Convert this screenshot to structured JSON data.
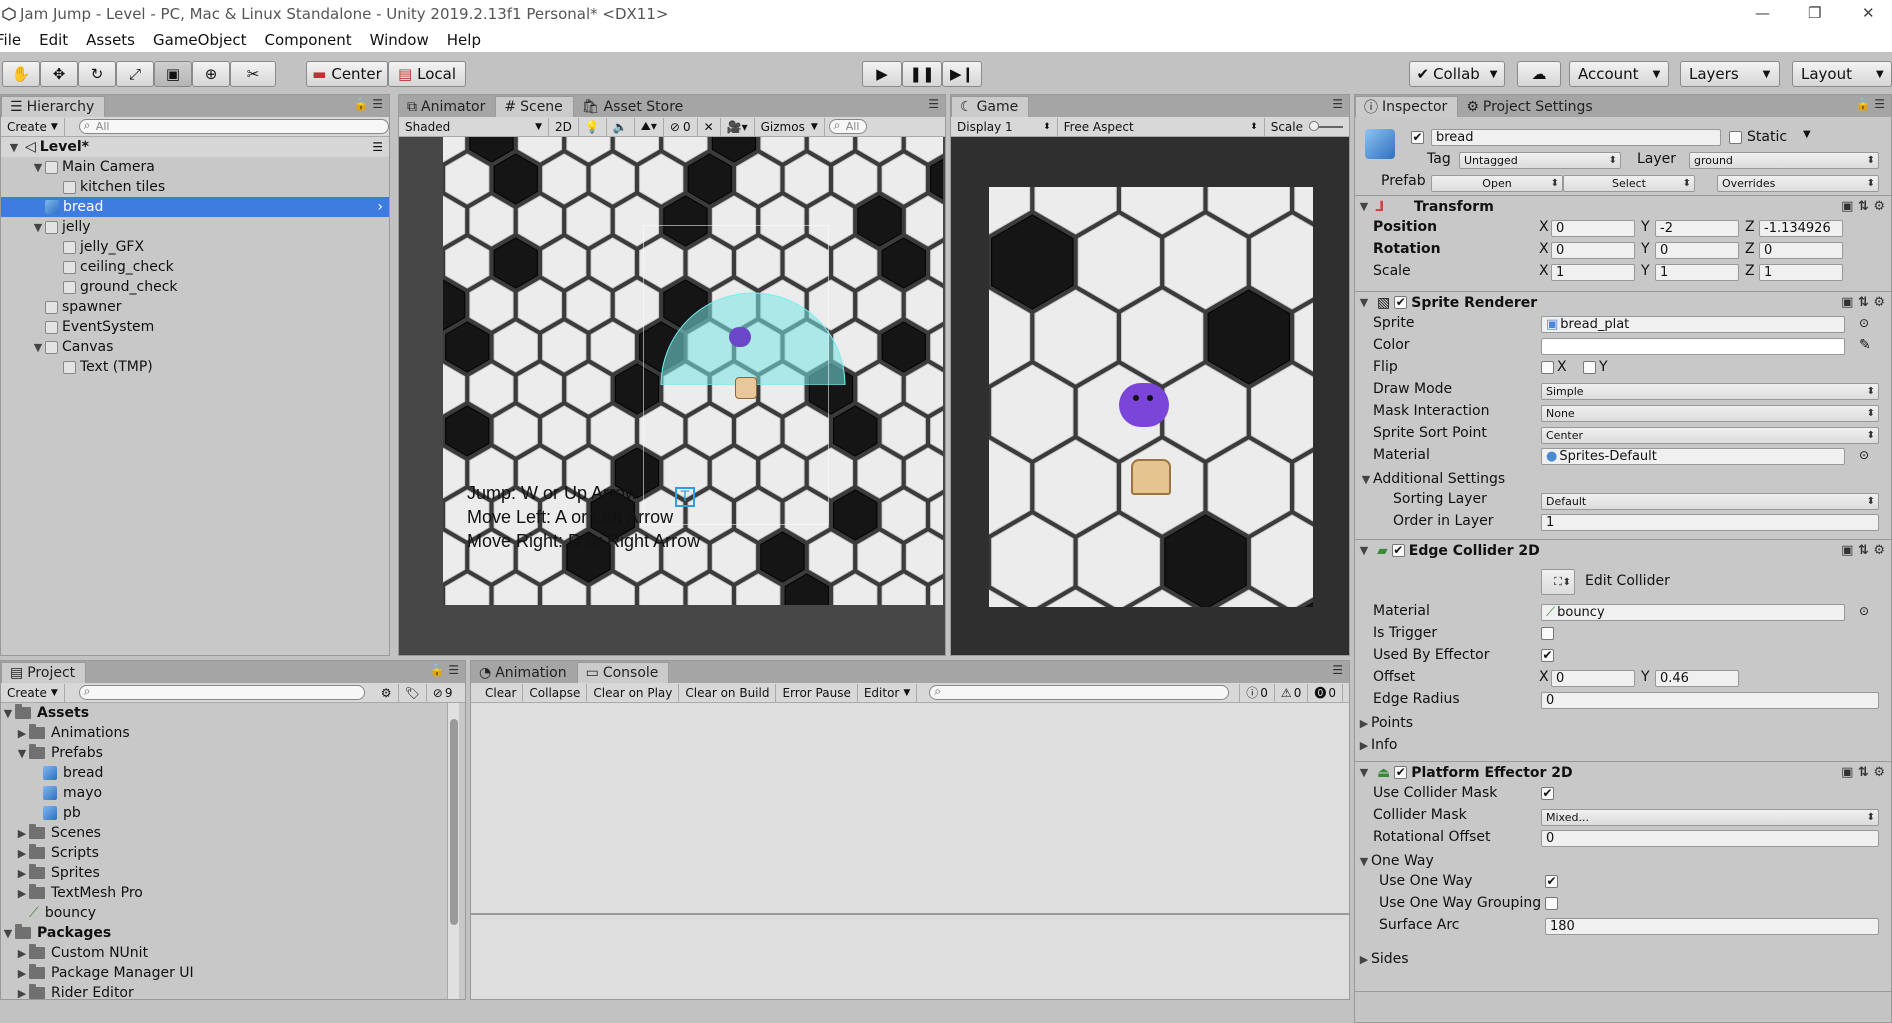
{
  "window": {
    "title": "Jam Jump - Level - PC, Mac & Linux Standalone - Unity 2019.2.13f1 Personal* <DX11>",
    "controls": [
      "—",
      "❐",
      "✕"
    ]
  },
  "menu": [
    "File",
    "Edit",
    "Assets",
    "GameObject",
    "Component",
    "Window",
    "Help"
  ],
  "toolbar": {
    "pivot": "Center",
    "space": "Local",
    "collab": "Collab",
    "account": "Account",
    "layers": "Layers",
    "layout": "Layout"
  },
  "hierarchy": {
    "tab": "Hierarchy",
    "create": "Create",
    "search_placeholder": "All",
    "scene": "Level*",
    "items": [
      {
        "label": "Main Camera",
        "depth": 1,
        "expanded": true
      },
      {
        "label": "kitchen tiles",
        "depth": 2
      },
      {
        "label": "bread",
        "depth": 1,
        "selected": true
      },
      {
        "label": "jelly",
        "depth": 1,
        "expanded": true
      },
      {
        "label": "jelly_GFX",
        "depth": 2
      },
      {
        "label": "ceiling_check",
        "depth": 2
      },
      {
        "label": "ground_check",
        "depth": 2
      },
      {
        "label": "spawner",
        "depth": 1
      },
      {
        "label": "EventSystem",
        "depth": 1
      },
      {
        "label": "Canvas",
        "depth": 1,
        "expanded": true
      },
      {
        "label": "Text (TMP)",
        "depth": 2
      }
    ]
  },
  "scene": {
    "tabs": [
      "Animator",
      "Scene",
      "Asset Store"
    ],
    "shading": "Shaded",
    "mode2d": "2D",
    "gizmo_count": "0",
    "gizmos": "Gizmos",
    "search_placeholder": "All",
    "ui_text": [
      "Jump: W or Up Arrow",
      "Move Left: A or Left Arrow",
      "Move Right: D or Right Arrow"
    ]
  },
  "game": {
    "tab": "Game",
    "display": "Display 1",
    "aspect": "Free Aspect",
    "scale": "Scale"
  },
  "project": {
    "tab": "Project",
    "create": "Create",
    "hidden_count": "9",
    "items": [
      {
        "label": "Assets",
        "depth": 0,
        "type": "folder",
        "bold": true,
        "expanded": true
      },
      {
        "label": "Animations",
        "depth": 1,
        "type": "folder"
      },
      {
        "label": "Prefabs",
        "depth": 1,
        "type": "folder",
        "expanded": true
      },
      {
        "label": "bread",
        "depth": 2,
        "type": "prefab"
      },
      {
        "label": "mayo",
        "depth": 2,
        "type": "prefab"
      },
      {
        "label": "pb",
        "depth": 2,
        "type": "prefab"
      },
      {
        "label": "Scenes",
        "depth": 1,
        "type": "folder"
      },
      {
        "label": "Scripts",
        "depth": 1,
        "type": "folder"
      },
      {
        "label": "Sprites",
        "depth": 1,
        "type": "folder"
      },
      {
        "label": "TextMesh Pro",
        "depth": 1,
        "type": "folder"
      },
      {
        "label": "bouncy",
        "depth": 1,
        "type": "material"
      },
      {
        "label": "Packages",
        "depth": 0,
        "type": "folder",
        "bold": true,
        "expanded": true
      },
      {
        "label": "Custom NUnit",
        "depth": 1,
        "type": "folder"
      },
      {
        "label": "Package Manager UI",
        "depth": 1,
        "type": "folder"
      },
      {
        "label": "Rider Editor",
        "depth": 1,
        "type": "folder"
      }
    ]
  },
  "console": {
    "tabs": [
      "Animation",
      "Console"
    ],
    "buttons": [
      "Clear",
      "Collapse",
      "Clear on Play",
      "Clear on Build",
      "Error Pause",
      "Editor"
    ],
    "counts": [
      "0",
      "0",
      "0"
    ]
  },
  "inspector": {
    "tabs": [
      "Inspector",
      "Project Settings"
    ],
    "name": "bread",
    "static_label": "Static",
    "tag_label": "Tag",
    "tag": "Untagged",
    "layer_label": "Layer",
    "layer": "ground",
    "prefab_label": "Prefab",
    "prefab_open": "Open",
    "prefab_select": "Select",
    "prefab_overrides": "Overrides",
    "transform": {
      "title": "Transform",
      "position_label": "Position",
      "pos_x": "0",
      "pos_y": "-2",
      "pos_z": "-1.134926",
      "rotation_label": "Rotation",
      "rot_x": "0",
      "rot_y": "0",
      "rot_z": "0",
      "scale_label": "Scale",
      "scl_x": "1",
      "scl_y": "1",
      "scl_z": "1"
    },
    "sprite_renderer": {
      "title": "Sprite Renderer",
      "sprite_label": "Sprite",
      "sprite": "bread_plat",
      "color_label": "Color",
      "flip_label": "Flip",
      "flip_x": "X",
      "flip_y": "Y",
      "draw_mode_label": "Draw Mode",
      "draw_mode": "Simple",
      "mask_label": "Mask Interaction",
      "mask": "None",
      "sort_point_label": "Sprite Sort Point",
      "sort_point": "Center",
      "material_label": "Material",
      "material": "Sprites-Default",
      "additional": "Additional Settings",
      "sorting_layer_label": "Sorting Layer",
      "sorting_layer": "Default",
      "order_label": "Order in Layer",
      "order": "1"
    },
    "edge_collider": {
      "title": "Edge Collider 2D",
      "edit_collider": "Edit Collider",
      "material_label": "Material",
      "material": "bouncy",
      "is_trigger_label": "Is Trigger",
      "used_by_effector_label": "Used By Effector",
      "offset_label": "Offset",
      "offset_x": "0",
      "offset_y": "0.46",
      "edge_radius_label": "Edge Radius",
      "edge_radius": "0",
      "points_label": "Points",
      "info_label": "Info"
    },
    "platform_effector": {
      "title": "Platform Effector 2D",
      "use_collider_mask_label": "Use Collider Mask",
      "collider_mask_label": "Collider Mask",
      "collider_mask": "Mixed...",
      "rotational_offset_label": "Rotational Offset",
      "rotational_offset": "0",
      "one_way_label": "One Way",
      "use_one_way_label": "Use One Way",
      "use_one_way_grouping_label": "Use One Way Grouping",
      "surface_arc_label": "Surface Arc",
      "surface_arc": "180",
      "sides_label": "Sides"
    }
  }
}
